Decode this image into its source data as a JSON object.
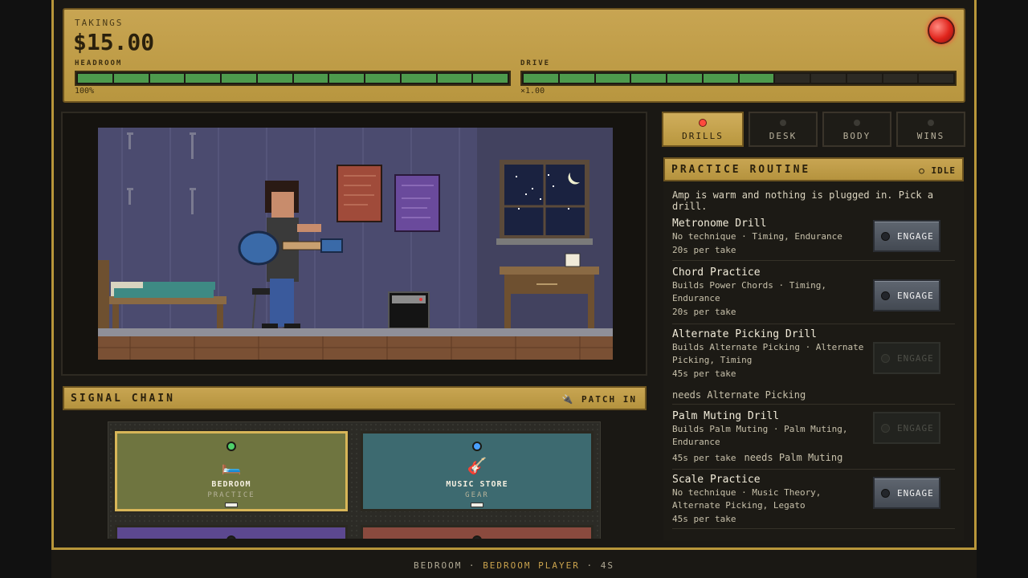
{
  "status": {
    "takings_label": "TAKINGS",
    "takings_value": "$15.00",
    "headroom_label": "HEADROOM",
    "headroom_value": "100%",
    "headroom_fraction": 1.0,
    "drive_label": "DRIVE",
    "drive_value": "×1.00",
    "drive_fraction": 0.6
  },
  "tabs": [
    {
      "label": "DRILLS",
      "active": true
    },
    {
      "label": "DESK",
      "active": false
    },
    {
      "label": "BODY",
      "active": false
    },
    {
      "label": "WINS",
      "active": false
    }
  ],
  "routine": {
    "title": "PRACTICE ROUTINE",
    "status": "○ IDLE",
    "intro": "Amp is warm and nothing is plugged in. Pick a drill.",
    "engage_label": "ENGAGE",
    "drills": [
      {
        "name": "Metronome Drill",
        "desc": "No technique · Timing, Endurance",
        "time": "20s per take",
        "need": "",
        "enabled": true
      },
      {
        "name": "Chord Practice",
        "desc": "Builds Power Chords · Timing, Endurance",
        "time": "20s per take",
        "need": "",
        "enabled": true
      },
      {
        "name": "Alternate Picking Drill",
        "desc": "Builds Alternate Picking · Alternate Picking, Timing",
        "time": "45s per take",
        "need": "needs Alternate Picking",
        "enabled": false
      },
      {
        "name": "Palm Muting Drill",
        "desc": "Builds Palm Muting · Palm Muting, Endurance",
        "time": "45s per take",
        "need": "needs Palm Muting",
        "enabled": false
      },
      {
        "name": "Scale Practice",
        "desc": "No technique · Music Theory, Alternate Picking, Legato",
        "time": "45s per take",
        "need": "",
        "enabled": true
      }
    ]
  },
  "chain": {
    "title": "SIGNAL CHAIN",
    "patch_label": "🔌 PATCH IN",
    "nodes": [
      {
        "name": "BEDROOM",
        "sub": "PRACTICE",
        "icon": "🛏️",
        "color": "#6f7540",
        "led": "#4fd06a",
        "selected": true
      },
      {
        "name": "MUSIC STORE",
        "sub": "GEAR",
        "icon": "🎸",
        "color": "#3d6a70",
        "led": "#49a0ff",
        "selected": false
      },
      {
        "name": "",
        "sub": "",
        "icon": "",
        "color": "#5c4890",
        "led": "#222",
        "selected": false
      },
      {
        "name": "",
        "sub": "",
        "icon": "",
        "color": "#8a4a3e",
        "led": "#222",
        "selected": false
      }
    ]
  },
  "footer": {
    "location": "BEDROOM",
    "sep1": " · ",
    "rank": "BEDROOM PLAYER",
    "sep2": " · ",
    "time": "4S"
  }
}
